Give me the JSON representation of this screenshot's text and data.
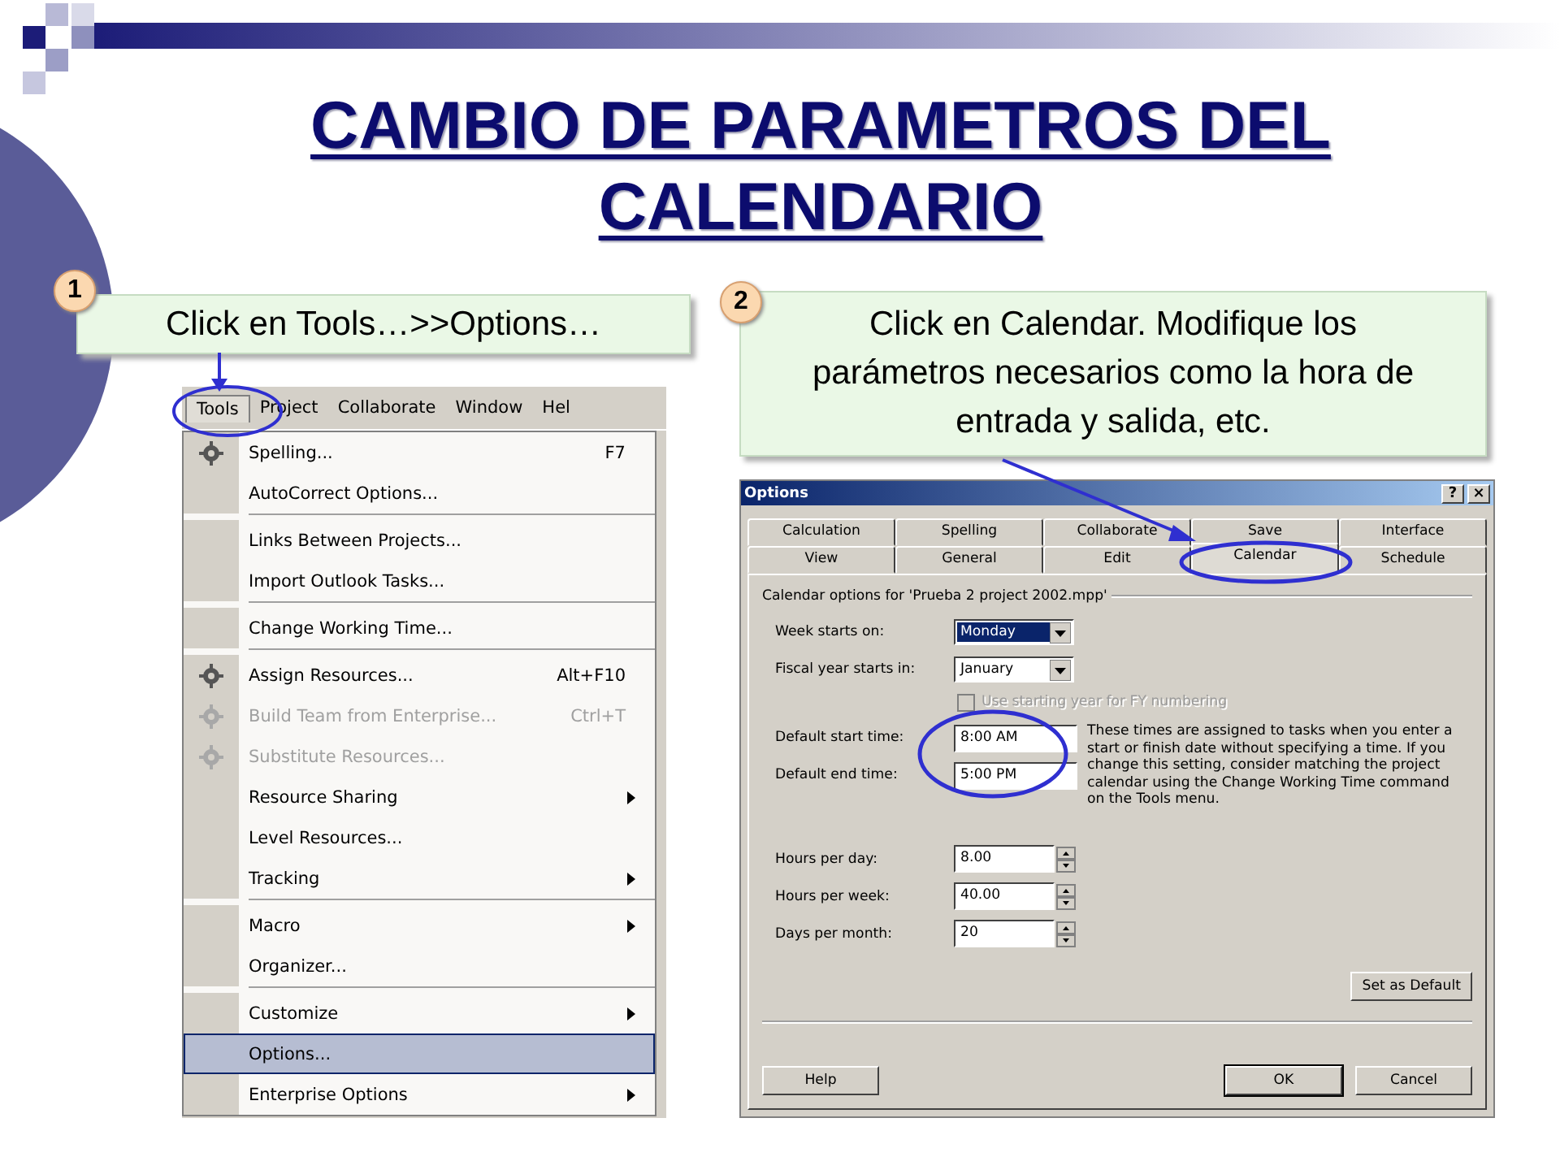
{
  "title": "CAMBIO DE PARAMETROS DEL CALENDARIO",
  "steps": [
    {
      "number": "1",
      "text": "Click en Tools…>>Options…"
    },
    {
      "number": "2",
      "text": "Click en Calendar. Modifique los parámetros necesarios como la hora de entrada y salida, etc."
    }
  ],
  "menu": {
    "menubar": [
      {
        "label": "Tools",
        "selected": true
      },
      {
        "label": "Project",
        "selected": false
      },
      {
        "label": "Collaborate",
        "selected": false
      },
      {
        "label": "Window",
        "selected": false
      },
      {
        "label": "Hel",
        "selected": false
      }
    ],
    "items": [
      {
        "kind": "item",
        "label": "Spelling...",
        "shortcut": "F7",
        "icon": true,
        "disabled": false,
        "submenu": false,
        "selected": false
      },
      {
        "kind": "item",
        "label": "AutoCorrect Options...",
        "icon": false,
        "disabled": false,
        "submenu": false,
        "selected": false
      },
      {
        "kind": "separator"
      },
      {
        "kind": "item",
        "label": "Links Between Projects...",
        "icon": false,
        "disabled": false,
        "submenu": false,
        "selected": false
      },
      {
        "kind": "item",
        "label": "Import Outlook Tasks...",
        "icon": false,
        "disabled": false,
        "submenu": false,
        "selected": false
      },
      {
        "kind": "separator"
      },
      {
        "kind": "item",
        "label": "Change Working Time...",
        "icon": false,
        "disabled": false,
        "submenu": false,
        "selected": false
      },
      {
        "kind": "separator"
      },
      {
        "kind": "item",
        "label": "Assign Resources...",
        "shortcut": "Alt+F10",
        "icon": true,
        "disabled": false,
        "submenu": false,
        "selected": false
      },
      {
        "kind": "item",
        "label": "Build Team from Enterprise...",
        "shortcut": "Ctrl+T",
        "icon": true,
        "disabled": true,
        "submenu": false,
        "selected": false
      },
      {
        "kind": "item",
        "label": "Substitute Resources...",
        "icon": true,
        "disabled": true,
        "submenu": false,
        "selected": false
      },
      {
        "kind": "item",
        "label": "Resource Sharing",
        "icon": false,
        "disabled": false,
        "submenu": true,
        "selected": false
      },
      {
        "kind": "item",
        "label": "Level Resources...",
        "icon": false,
        "disabled": false,
        "submenu": false,
        "selected": false
      },
      {
        "kind": "item",
        "label": "Tracking",
        "icon": false,
        "disabled": false,
        "submenu": true,
        "selected": false
      },
      {
        "kind": "separator"
      },
      {
        "kind": "item",
        "label": "Macro",
        "icon": false,
        "disabled": false,
        "submenu": true,
        "selected": false
      },
      {
        "kind": "item",
        "label": "Organizer...",
        "icon": false,
        "disabled": false,
        "submenu": false,
        "selected": false
      },
      {
        "kind": "separator"
      },
      {
        "kind": "item",
        "label": "Customize",
        "icon": false,
        "disabled": false,
        "submenu": true,
        "selected": false
      },
      {
        "kind": "item",
        "label": "Options...",
        "icon": false,
        "disabled": false,
        "submenu": false,
        "selected": true
      },
      {
        "kind": "item",
        "label": "Enterprise Options",
        "icon": false,
        "disabled": false,
        "submenu": true,
        "selected": false
      }
    ]
  },
  "dialog": {
    "title": "Options",
    "title_buttons": [
      "?",
      "×"
    ],
    "tab_rows": [
      [
        {
          "label": "Calculation",
          "selected": false
        },
        {
          "label": "Spelling",
          "selected": false
        },
        {
          "label": "Collaborate",
          "selected": false
        },
        {
          "label": "Save",
          "selected": false
        },
        {
          "label": "Interface",
          "selected": false
        }
      ],
      [
        {
          "label": "View",
          "selected": false
        },
        {
          "label": "General",
          "selected": false
        },
        {
          "label": "Edit",
          "selected": false
        },
        {
          "label": "Calendar",
          "selected": true
        },
        {
          "label": "Schedule",
          "selected": false
        }
      ]
    ],
    "group_label": "Calendar options for 'Prueba 2 project 2002.mpp'",
    "top_fields": [
      {
        "kind": "dropdown",
        "label": "Week starts on:",
        "value": "Monday",
        "highlighted": true
      },
      {
        "kind": "dropdown",
        "label": "Fiscal year starts in:",
        "value": "January",
        "highlighted": false
      },
      {
        "kind": "checkbox",
        "label": "Use starting year for FY numbering",
        "checked": false,
        "disabled": true
      }
    ],
    "time_fields": [
      {
        "kind": "text",
        "label": "Default start time:",
        "value": "8:00 AM"
      },
      {
        "kind": "text",
        "label": "Default end time:",
        "value": "5:00 PM"
      }
    ],
    "time_note": "These times are assigned to tasks when you enter a start or finish date without specifying a time. If you change this setting, consider matching the project calendar using the Change Working Time command on the Tools menu.",
    "count_fields": [
      {
        "kind": "spinner",
        "label": "Hours per day:",
        "value": "8.00"
      },
      {
        "kind": "spinner",
        "label": "Hours per week:",
        "value": "40.00"
      },
      {
        "kind": "spinner",
        "label": "Days per month:",
        "value": "20"
      }
    ],
    "default_button": "Set as Default",
    "help_button": "Help",
    "buttons": [
      {
        "label": "OK",
        "default": true
      },
      {
        "label": "Cancel",
        "default": false
      }
    ]
  }
}
